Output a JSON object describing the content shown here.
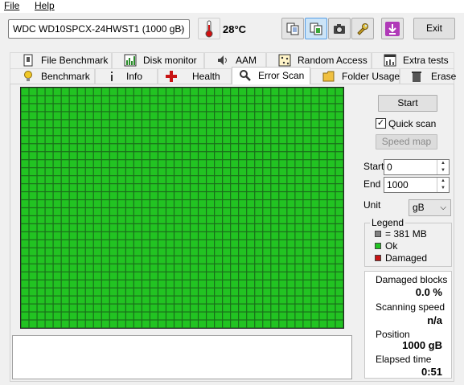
{
  "menu": {
    "file": "File",
    "help": "Help"
  },
  "toolbar": {
    "drive": "WDC WD10SPCX-24HWST1 (1000 gB)",
    "temperature": "28°C",
    "exit_label": "Exit"
  },
  "tabs_row1": [
    "File Benchmark",
    "Disk monitor",
    "AAM",
    "Random Access",
    "Extra tests"
  ],
  "tabs_row2": [
    "Benchmark",
    "Info",
    "Health",
    "Error Scan",
    "Folder Usage",
    "Erase"
  ],
  "selected_tab": "Error Scan",
  "controls": {
    "start_button": "Start",
    "quick_scan_label": "Quick scan",
    "quick_scan_checked": true,
    "speed_map_button": "Speed map",
    "start_label": "Start",
    "start_value": "0",
    "end_label": "End",
    "end_value": "1000",
    "unit_label": "Unit",
    "unit_value": "gB"
  },
  "legend": {
    "title": "Legend",
    "items": [
      {
        "color": "#808080",
        "label": "= 381 MB"
      },
      {
        "color": "#22c322",
        "label": "Ok"
      },
      {
        "color": "#c81414",
        "label": "Damaged"
      }
    ]
  },
  "stats": {
    "damaged_blocks_label": "Damaged blocks",
    "damaged_blocks_value": "0.0 %",
    "scanning_speed_label": "Scanning speed",
    "scanning_speed_value": "n/a",
    "position_label": "Position",
    "position_value": "1000 gB",
    "elapsed_label": "Elapsed time",
    "elapsed_value": "0:51"
  },
  "scan_grid": {
    "columns": 40,
    "rows": 30,
    "block_color": "#22c322",
    "border_color": "#1a6e1a"
  },
  "colors": {
    "ok": "#22c322",
    "accent": "#0078d7"
  }
}
